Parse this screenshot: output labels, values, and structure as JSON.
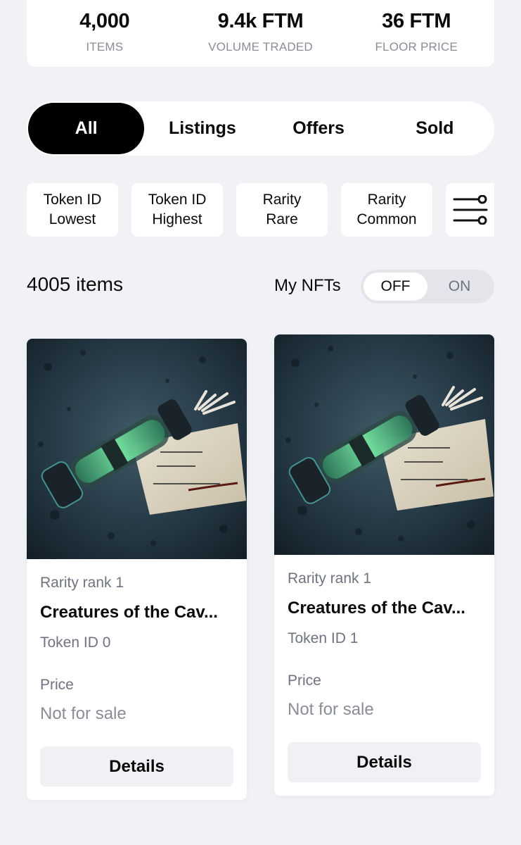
{
  "stats": [
    {
      "value": "4,000",
      "label": "ITEMS"
    },
    {
      "value": "9.4k FTM",
      "label": "VOLUME TRADED"
    },
    {
      "value": "36 FTM",
      "label": "FLOOR PRICE"
    }
  ],
  "tabs": [
    {
      "label": "All",
      "active": true
    },
    {
      "label": "Listings"
    },
    {
      "label": "Offers"
    },
    {
      "label": "Sold"
    }
  ],
  "filters": [
    {
      "line1": "Token ID",
      "line2": "Lowest"
    },
    {
      "line1": "Token ID",
      "line2": "Highest"
    },
    {
      "line1": "Rarity",
      "line2": "Rare"
    },
    {
      "line1": "Rarity",
      "line2": "Common"
    }
  ],
  "filter_settings_icon": "sliders-icon",
  "item_count": "4005 items",
  "my_nfts": {
    "label": "My NFTs",
    "off": "OFF",
    "on": "ON",
    "state": "OFF"
  },
  "cards": [
    {
      "rarity": "Rarity rank 1",
      "name": "Creatures of the Cav...",
      "token": "Token ID 0",
      "price_label": "Price",
      "price": "Not for sale",
      "button": "Details",
      "image": "glowing-vial-on-note-image"
    },
    {
      "rarity": "Rarity rank 1",
      "name": "Creatures of the Cav...",
      "token": "Token ID 1",
      "price_label": "Price",
      "price": "Not for sale",
      "button": "Details",
      "image": "glowing-vial-on-note-image"
    }
  ],
  "colors": {
    "background": "#f1f2f6",
    "active_tab": "#000000",
    "button_bg": "#f0f1f5",
    "muted_text": "#6f7380"
  }
}
